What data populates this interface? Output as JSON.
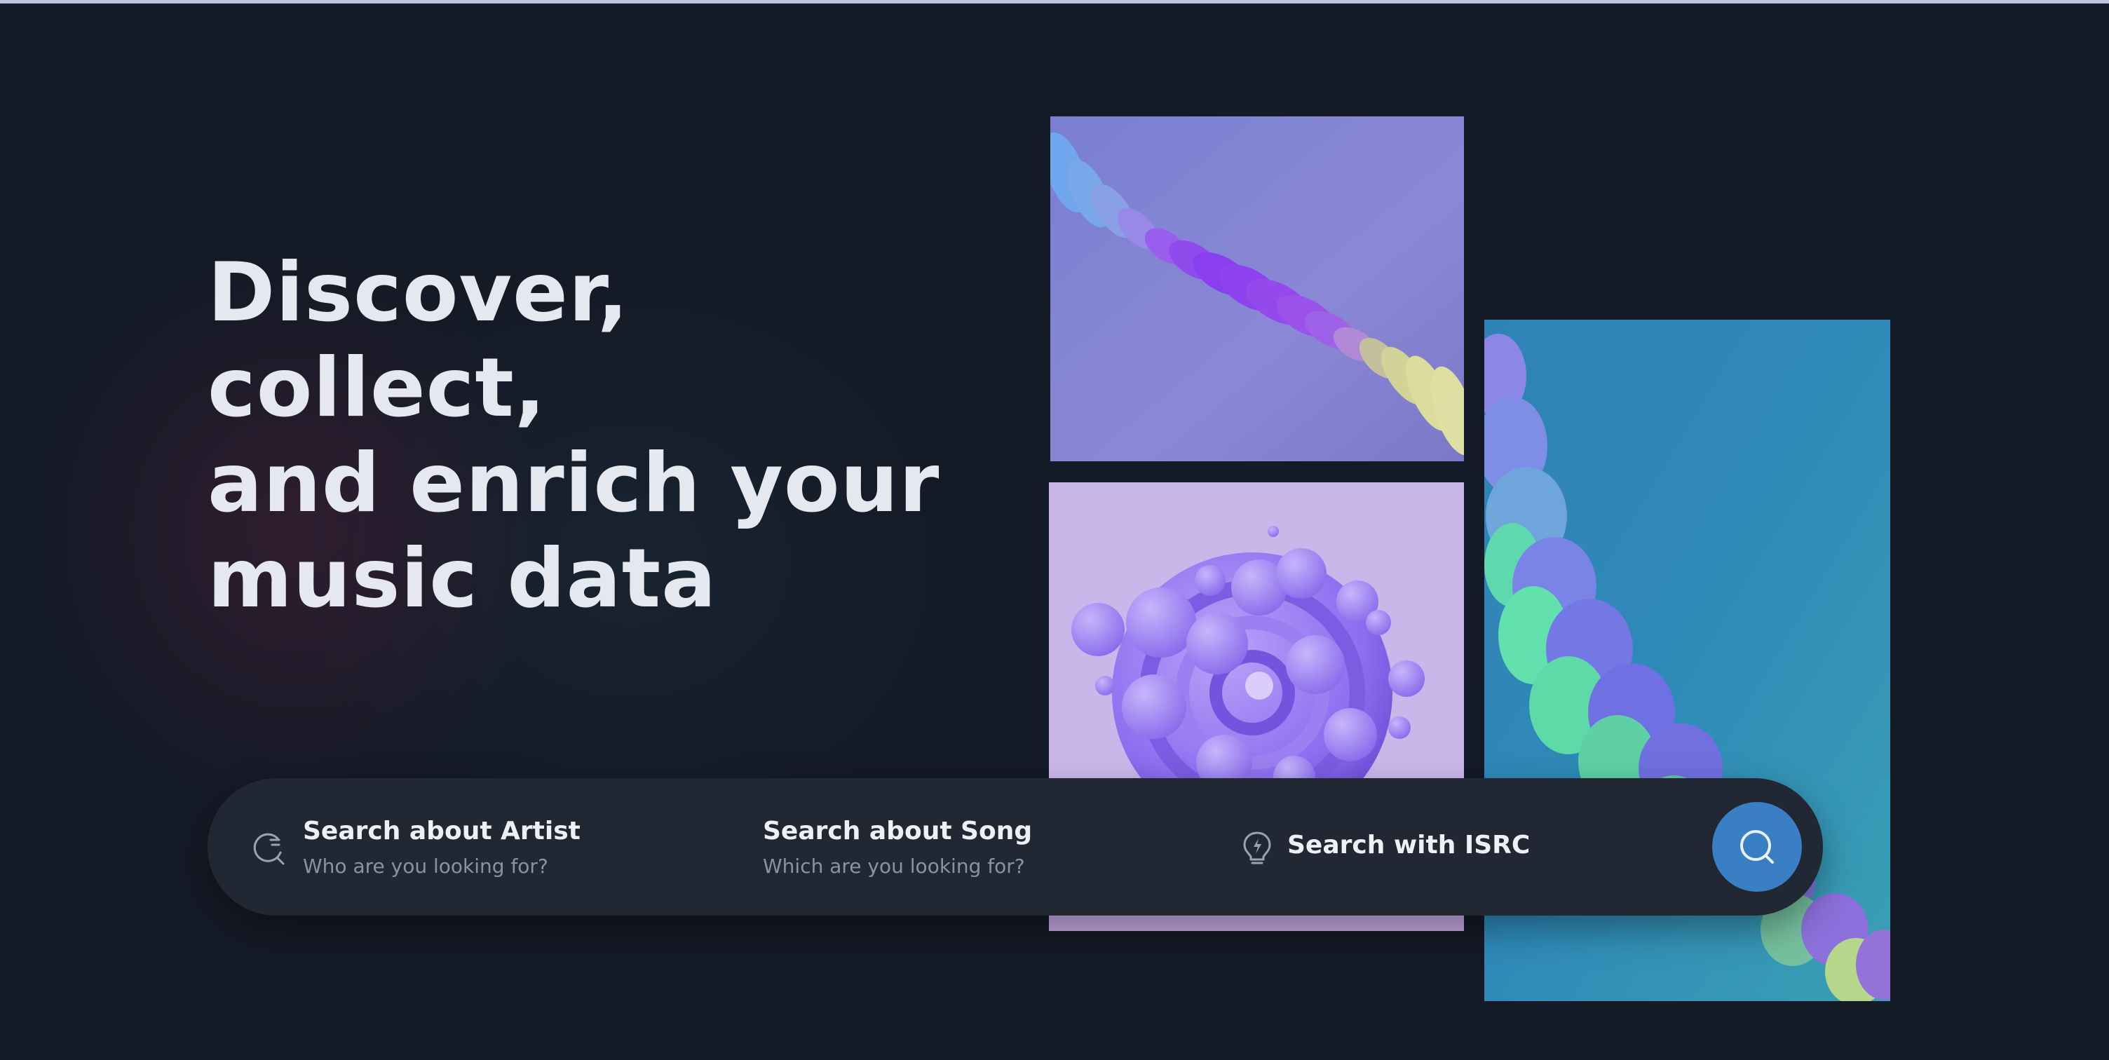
{
  "hero": {
    "title_lines": [
      "Discover, collect,",
      "and enrich your",
      "music data"
    ]
  },
  "artwork": {
    "top": "purple-spiral-ribbon-artwork",
    "middle": "lavender-bubble-swirl-artwork",
    "right": "teal-wave-ribbon-artwork"
  },
  "search": {
    "artist": {
      "title": "Search about Artist",
      "placeholder": "Who are you looking for?",
      "icon": "artist-search-icon"
    },
    "song": {
      "title": "Search about Song",
      "placeholder": "Which are you looking for?"
    },
    "isrc": {
      "title": "Search with ISRC",
      "icon": "bulb-icon"
    },
    "submit_icon": "search-icon"
  },
  "colors": {
    "background": "#141a26",
    "search_bar": "#212833",
    "accent": "#3a7fc4",
    "heading": "#e6e8ef",
    "muted": "#8a93a3"
  }
}
